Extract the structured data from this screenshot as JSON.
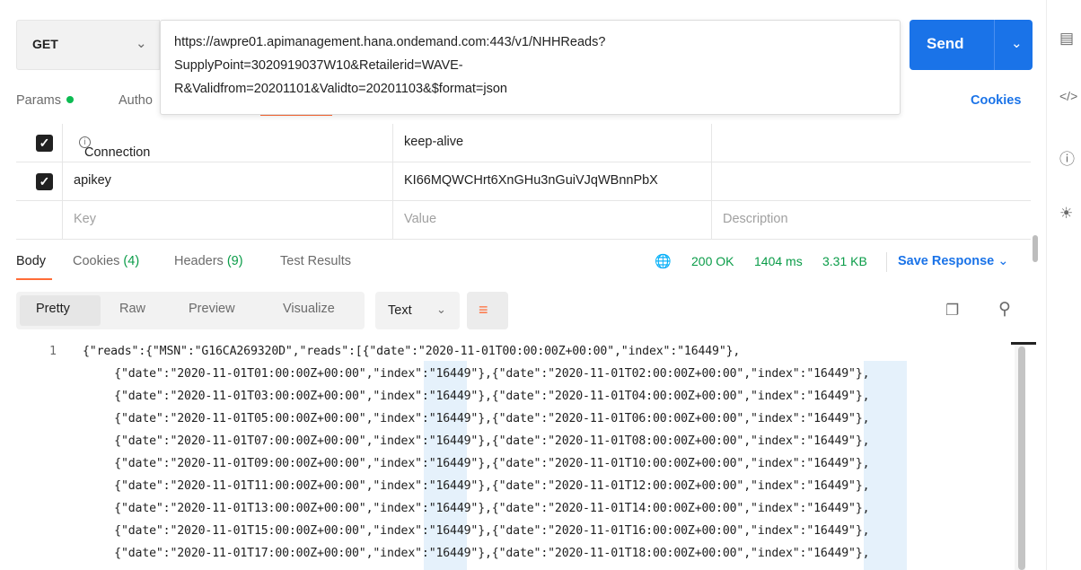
{
  "request": {
    "method": "GET",
    "url_lines": [
      "https://awpre01.apimanagement.hana.ondemand.com:443/v1/NHHReads?",
      "SupplyPoint=3020919037W10&Retailerid=WAVE-",
      "R&Validfrom=20201101&Validto=20201103&$format=json"
    ],
    "send_label": "Send",
    "cookies_label": "Cookies"
  },
  "request_tabs": {
    "params": "Params",
    "auth": "Autho"
  },
  "headers_table": {
    "rows": [
      {
        "key": "Connection",
        "value": "keep-alive",
        "checked": true
      },
      {
        "key": "apikey",
        "value": "KI66MQWCHrt6XnGHu3nGuiVJqWBnnPbX",
        "checked": true
      }
    ],
    "placeholder": {
      "key": "Key",
      "value": "Value",
      "description": "Description"
    }
  },
  "response_tabs": {
    "body": "Body",
    "cookies": "Cookies",
    "cookies_count": "(4)",
    "headers": "Headers",
    "headers_count": "(9)",
    "test_results": "Test Results"
  },
  "response_status": {
    "status": "200 OK",
    "time": "1404 ms",
    "size": "3.31 KB",
    "save_label": "Save Response"
  },
  "view_modes": [
    "Pretty",
    "Raw",
    "Preview",
    "Visualize"
  ],
  "format": "Text",
  "code": {
    "line_number": "1",
    "lines": [
      "{\"reads\":{\"MSN\":\"G16CA269320D\",\"reads\":[{\"date\":\"2020-11-01T00:00:00Z+00:00\",\"index\":\"16449\"},",
      "    {\"date\":\"2020-11-01T01:00:00Z+00:00\",\"index\":\"16449\"},{\"date\":\"2020-11-01T02:00:00Z+00:00\",\"index\":\"16449\"},",
      "    {\"date\":\"2020-11-01T03:00:00Z+00:00\",\"index\":\"16449\"},{\"date\":\"2020-11-01T04:00:00Z+00:00\",\"index\":\"16449\"},",
      "    {\"date\":\"2020-11-01T05:00:00Z+00:00\",\"index\":\"16449\"},{\"date\":\"2020-11-01T06:00:00Z+00:00\",\"index\":\"16449\"},",
      "    {\"date\":\"2020-11-01T07:00:00Z+00:00\",\"index\":\"16449\"},{\"date\":\"2020-11-01T08:00:00Z+00:00\",\"index\":\"16449\"},",
      "    {\"date\":\"2020-11-01T09:00:00Z+00:00\",\"index\":\"16449\"},{\"date\":\"2020-11-01T10:00:00Z+00:00\",\"index\":\"16449\"},",
      "    {\"date\":\"2020-11-01T11:00:00Z+00:00\",\"index\":\"16449\"},{\"date\":\"2020-11-01T12:00:00Z+00:00\",\"index\":\"16449\"},",
      "    {\"date\":\"2020-11-01T13:00:00Z+00:00\",\"index\":\"16449\"},{\"date\":\"2020-11-01T14:00:00Z+00:00\",\"index\":\"16449\"},",
      "    {\"date\":\"2020-11-01T15:00:00Z+00:00\",\"index\":\"16449\"},{\"date\":\"2020-11-01T16:00:00Z+00:00\",\"index\":\"16449\"},",
      "    {\"date\":\"2020-11-01T17:00:00Z+00:00\",\"index\":\"16449\"},{\"date\":\"2020-11-01T18:00:00Z+00:00\",\"index\":\"16449\"},"
    ]
  },
  "colors": {
    "accent": "#ff6c37",
    "send": "#1a73e8",
    "ok_green": "#0a9c48"
  },
  "icons": {
    "right_rail": [
      "document-icon",
      "code-icon",
      "info-icon",
      "lightbulb-icon"
    ]
  }
}
